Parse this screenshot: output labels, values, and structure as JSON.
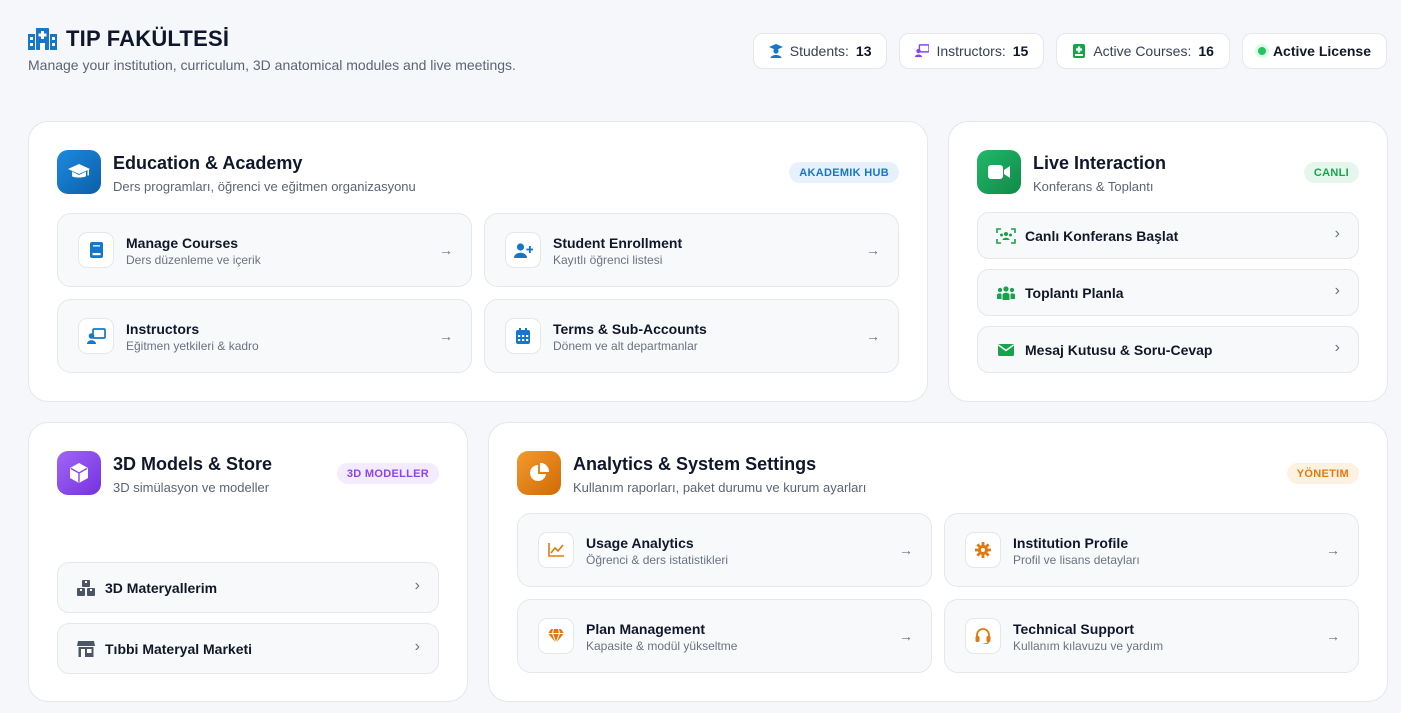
{
  "header": {
    "title": "TIP FAKÜLTESİ",
    "subtitle": "Manage your institution, curriculum, 3D anatomical modules and live meetings.",
    "stats": [
      {
        "label": "Students:",
        "value": "13",
        "icon": "students-icon"
      },
      {
        "label": "Instructors:",
        "value": "15",
        "icon": "instructor-icon"
      },
      {
        "label": "Active Courses:",
        "value": "16",
        "icon": "book-icon"
      }
    ],
    "license": "Active License"
  },
  "education": {
    "title": "Education & Academy",
    "subtitle": "Ders programları, öğrenci ve eğitmen organizasyonu",
    "badge": "AKADEMIK HUB",
    "tiles": [
      {
        "title": "Manage Courses",
        "sub": "Ders düzenleme ve içerik",
        "icon": "book-icon"
      },
      {
        "title": "Student Enrollment",
        "sub": "Kayıtlı öğrenci listesi",
        "icon": "user-plus-icon"
      },
      {
        "title": "Instructors",
        "sub": "Eğitmen yetkileri & kadro",
        "icon": "chalkboard-teacher-icon"
      },
      {
        "title": "Terms & Sub-Accounts",
        "sub": "Dönem ve alt departmanlar",
        "icon": "calendar-icon"
      }
    ]
  },
  "live": {
    "title": "Live Interaction",
    "subtitle": "Konferans & Toplantı",
    "badge": "CANLI",
    "items": [
      {
        "label": "Canlı Konferans Başlat",
        "icon": "conference-icon"
      },
      {
        "label": "Toplantı Planla",
        "icon": "group-icon"
      },
      {
        "label": "Mesaj Kutusu & Soru-Cevap",
        "icon": "envelope-icon"
      }
    ]
  },
  "models": {
    "title": "3D Models & Store",
    "subtitle": "3D simülasyon ve modeller",
    "badge": "3D MODELLER",
    "items": [
      {
        "label": "3D Materyallerim",
        "icon": "boxes-icon"
      },
      {
        "label": "Tıbbi Materyal Marketi",
        "icon": "store-icon"
      }
    ]
  },
  "analytics": {
    "title": "Analytics & System Settings",
    "subtitle": "Kullanım raporları, paket durumu ve kurum ayarları",
    "badge": "YÖNETIM",
    "tiles": [
      {
        "title": "Usage Analytics",
        "sub": "Öğrenci & ders istatistikleri",
        "icon": "line-chart-icon"
      },
      {
        "title": "Institution Profile",
        "sub": "Profil ve lisans detayları",
        "icon": "gear-icon"
      },
      {
        "title": "Plan Management",
        "sub": "Kapasite & modül yükseltme",
        "icon": "gem-icon"
      },
      {
        "title": "Technical Support",
        "sub": "Kullanım kılavuzu ve yardım",
        "icon": "headset-icon"
      }
    ]
  },
  "symbols": {
    "arrow": "→",
    "chevron": "›"
  },
  "colors": {
    "blue": "#1677c9",
    "green": "#16a34a",
    "purple": "#8b45f0",
    "orange": "#e07a10"
  }
}
